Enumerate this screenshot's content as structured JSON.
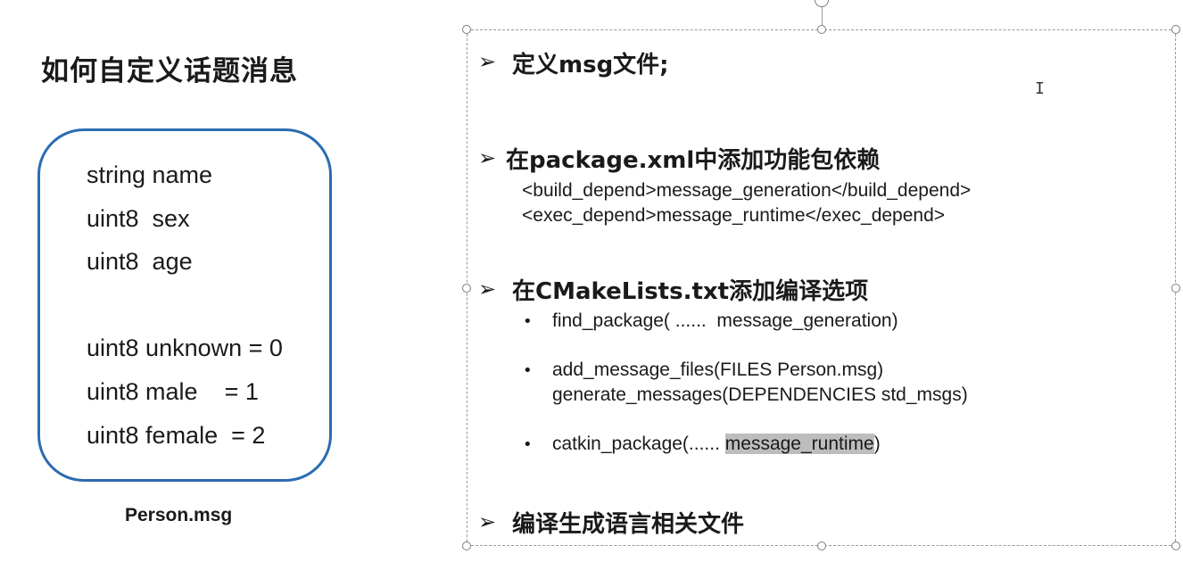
{
  "left_panel": {
    "title": "如何自定义话题消息",
    "msg_lines": [
      "string name",
      "uint8  sex",
      "uint8  age",
      "uint8 unknown = 0",
      "uint8 male    = 1",
      "uint8 female  = 2"
    ],
    "filename": "Person.msg"
  },
  "right_panel": {
    "arrow_glyph": "➢",
    "bullet_glyph": "•",
    "step1": "定义msg文件;",
    "step2": "在package.xml中添加功能包依赖",
    "step2_code": [
      "<build_depend>message_generation</build_depend>",
      "<exec_depend>message_runtime</exec_depend>"
    ],
    "step3": "在CMakeLists.txt添加编译选项",
    "step3_items": {
      "find": "find_package( ......  message_generation)",
      "add_files": "add_message_files(FILES Person.msg)",
      "generate": "generate_messages(DEPENDENCIES std_msgs)",
      "catkin_prefix": "catkin_package(...... ",
      "catkin_highlight": "message_runtime",
      "catkin_suffix": ")"
    },
    "step4": "编译生成语言相关文件"
  },
  "text_cursor": "I"
}
